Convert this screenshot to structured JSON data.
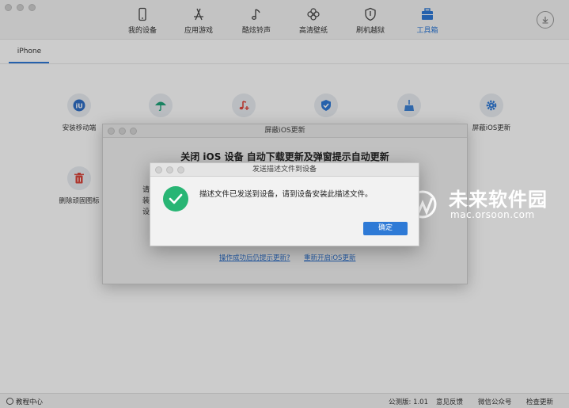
{
  "nav": [
    {
      "label": "我的设备",
      "icon": "phone-icon"
    },
    {
      "label": "应用游戏",
      "icon": "app-store-icon"
    },
    {
      "label": "酷炫铃声",
      "icon": "music-note-icon"
    },
    {
      "label": "高清壁纸",
      "icon": "flower-icon"
    },
    {
      "label": "刷机越狱",
      "icon": "shield-icon"
    },
    {
      "label": "工具箱",
      "icon": "toolbox-icon",
      "active": true
    }
  ],
  "tab": {
    "label": "iPhone"
  },
  "tools": [
    {
      "label": "安装移动端",
      "icon": "iu-app-icon",
      "color": "#2f6fc6"
    },
    {
      "label": "",
      "icon": "umbrella-icon",
      "color": "#1ea37a"
    },
    {
      "label": "",
      "icon": "music-plus-icon",
      "color": "#e0453c"
    },
    {
      "label": "",
      "icon": "shield-check-icon",
      "color": "#2f7ad8"
    },
    {
      "label": "",
      "icon": "broom-icon",
      "color": "#3d82d6"
    },
    {
      "label": "屏蔽iOS更新",
      "icon": "gear-icon",
      "color": "#2f7ad8"
    },
    {
      "label": "删除顽固图标",
      "icon": "trash-icon",
      "color": "#d9463c"
    }
  ],
  "status": {
    "help": "教程中心",
    "version": "公测版: 1.01",
    "feedback": "意见反馈",
    "wechat": "微信公众号",
    "update": "检查更新"
  },
  "watermark": {
    "title": "未来软件园",
    "url": "mac.orsoon.com"
  },
  "dialog1": {
    "title": "屏蔽iOS更新",
    "heading": "关闭 iOS 设备 自动下载更新及弹窗提示自动更新",
    "body": [
      "请",
      "装",
      "设"
    ],
    "link_left": "操作成功后仍提示更新?",
    "link_right": "重新开启iOS更新"
  },
  "dialog2": {
    "title": "发送描述文件到设备",
    "message": "描述文件已发送到设备，请到设备安装此描述文件。",
    "ok": "确定"
  },
  "colors": {
    "accent": "#2e7ad6",
    "success": "#28b574"
  }
}
